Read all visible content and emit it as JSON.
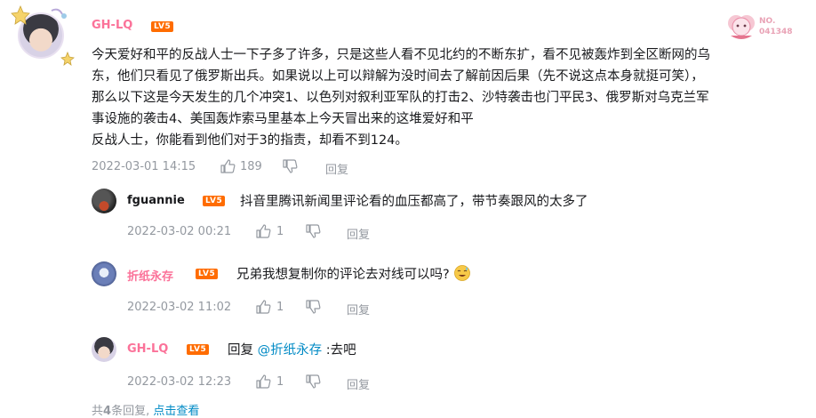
{
  "main_comment": {
    "username": "GH-LQ",
    "level": "LV5",
    "lines": [
      "今天爱好和平的反战人士一下子多了许多，只是这些人看不见北约的不断东扩，看不见被轰炸到全区断网的乌",
      "东，他们只看见了俄罗斯出兵。如果说以上可以辩解为没时间去了解前因后果（先不说这点本身就挺可笑），",
      "那么以下这是今天发生的几个冲突1、以色列对叙利亚军队的打击2、沙特袭击也门平民3、俄罗斯对乌克兰军",
      "事设施的袭击4、美国轰炸索马里基本上今天冒出来的这堆爱好和平",
      "反战人士，你能看到他们对于3的指责，却看不到124。"
    ],
    "date": "2022-03-01 14:15",
    "likes": "189",
    "reply_label": "回复"
  },
  "fan_badge": {
    "prefix": "NO.",
    "number": "041348"
  },
  "replies": [
    {
      "username": "fguannie",
      "name_color": "#18191c",
      "level": "LV5",
      "text": "抖音里腾讯新闻里评论看的血压都高了，带节奏跟风的太多了",
      "date": "2022-03-02 00:21",
      "likes": "1",
      "reply_label": "回复"
    },
    {
      "username": "折纸永存",
      "name_color": "#fb7299",
      "level": "LV5",
      "text": "兄弟我想复制你的评论去对线可以吗?",
      "emoji": "sweat-laugh-emoji",
      "date": "2022-03-02 11:02",
      "likes": "1",
      "reply_label": "回复"
    },
    {
      "username": "GH-LQ",
      "name_color": "#fb7299",
      "level": "LV5",
      "reply_prefix": "回复",
      "mention": "@折纸永存",
      "text": ":去吧",
      "date": "2022-03-02 12:23",
      "likes": "1",
      "reply_label": "回复"
    }
  ],
  "footer": {
    "total_prefix": "共",
    "total_count": "4",
    "total_suffix": "条回复,",
    "view_link": "点击查看"
  }
}
